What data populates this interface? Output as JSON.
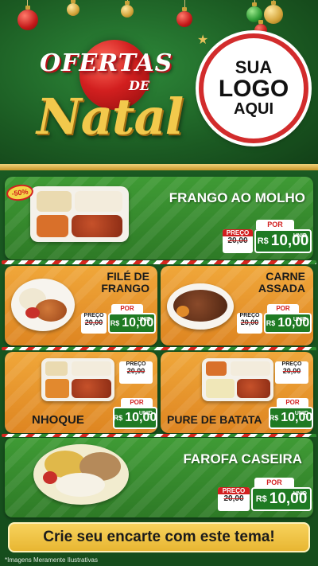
{
  "header": {
    "title_top": "OFERTAS",
    "title_de": "DE",
    "title_main": "Natal",
    "logo_line1": "SUA",
    "logo_line2": "LOGO",
    "logo_line3": "AQUI"
  },
  "colors": {
    "background_green": "#1c5f24",
    "accent_red": "#d21f1f",
    "accent_gold": "#f2c94c",
    "price_green": "#1f7a23",
    "card_orange": "#f0a73a"
  },
  "items": [
    {
      "name": "FRANGO AO MOLHO",
      "badge": "-50%",
      "preco_label": "PREÇO",
      "old_price": "20,00",
      "por_label": "POR",
      "currency": "R$",
      "new_price": "10,00",
      "unit": "UNID"
    },
    {
      "name_line1": "FILÉ DE",
      "name_line2": "FRANGO",
      "preco_label": "PREÇO",
      "old_price": "20,00",
      "por_label": "POR",
      "currency": "R$",
      "new_price": "10,00",
      "unit": "UNID"
    },
    {
      "name_line1": "CARNE",
      "name_line2": "ASSADA",
      "preco_label": "PREÇO",
      "old_price": "20,00",
      "por_label": "POR",
      "currency": "R$",
      "new_price": "10,00",
      "unit": "UNID"
    },
    {
      "name": "NHOQUE",
      "preco_label": "PREÇO",
      "old_price": "20,00",
      "por_label": "POR",
      "currency": "R$",
      "new_price": "10,00",
      "unit": "UNID"
    },
    {
      "name": "PURE DE BATATA",
      "preco_label": "PREÇO",
      "old_price": "20,00",
      "por_label": "POR",
      "currency": "R$",
      "new_price": "10,00",
      "unit": "UNID"
    },
    {
      "name": "FAROFA CASEIRA",
      "preco_label": "PREÇO",
      "old_price": "20,00",
      "por_label": "POR",
      "currency": "R$",
      "new_price": "10,00",
      "unit": "UNID"
    }
  ],
  "footer": {
    "cta": "Crie seu encarte com este tema!",
    "disclaimer": "*Imagens Meramente Ilustrativas"
  }
}
